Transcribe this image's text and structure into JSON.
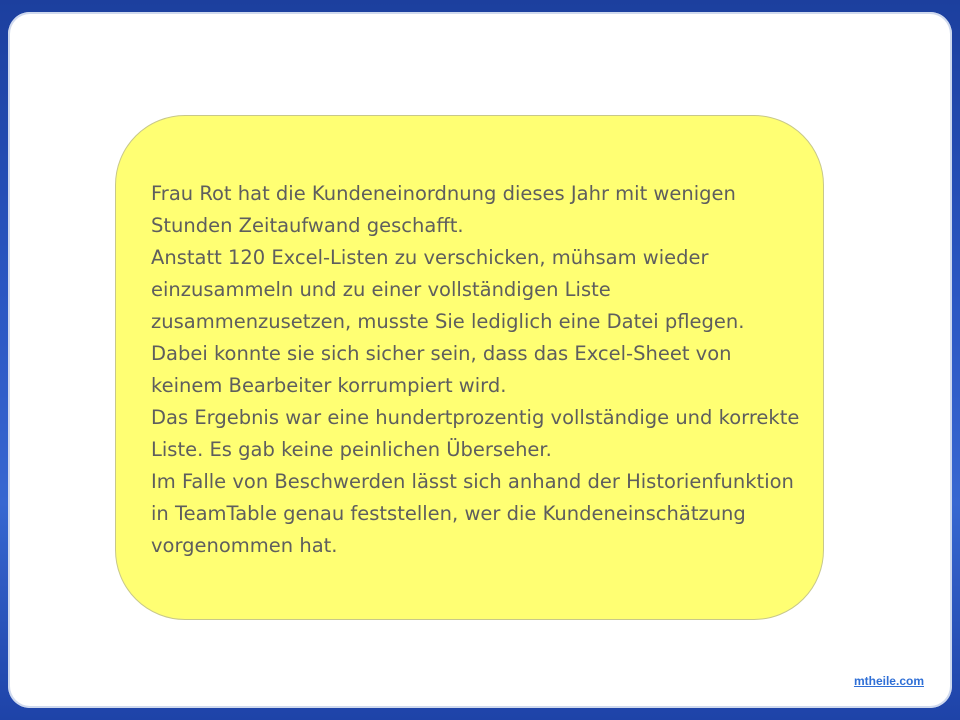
{
  "slide": {
    "paragraphs": [
      "Frau Rot hat die Kundeneinordnung dieses Jahr mit wenigen Stunden Zeitaufwand geschafft.",
      "Anstatt 120 Excel-Listen zu verschicken, mühsam wieder einzusammeln und zu einer vollständigen Liste zusammenzusetzen, musste Sie lediglich eine Datei pflegen. Dabei konnte sie sich sicher sein, dass das Excel-Sheet von keinem Bearbeiter korrumpiert wird.",
      "Das Ergebnis war eine hundertprozentig vollständige und korrekte Liste. Es gab keine peinlichen Überseher.",
      "Im Falle von Beschwerden lässt sich anhand der Historienfunktion in TeamTable genau feststellen, wer die Kundeneinschätzung vorgenommen hat."
    ]
  },
  "footer": {
    "link_text": "mtheile.com"
  },
  "colors": {
    "panel_fill": "#ffff73",
    "text": "#5e5e5e",
    "frame_blue": "#2a56c2",
    "link": "#2f6fd6"
  }
}
